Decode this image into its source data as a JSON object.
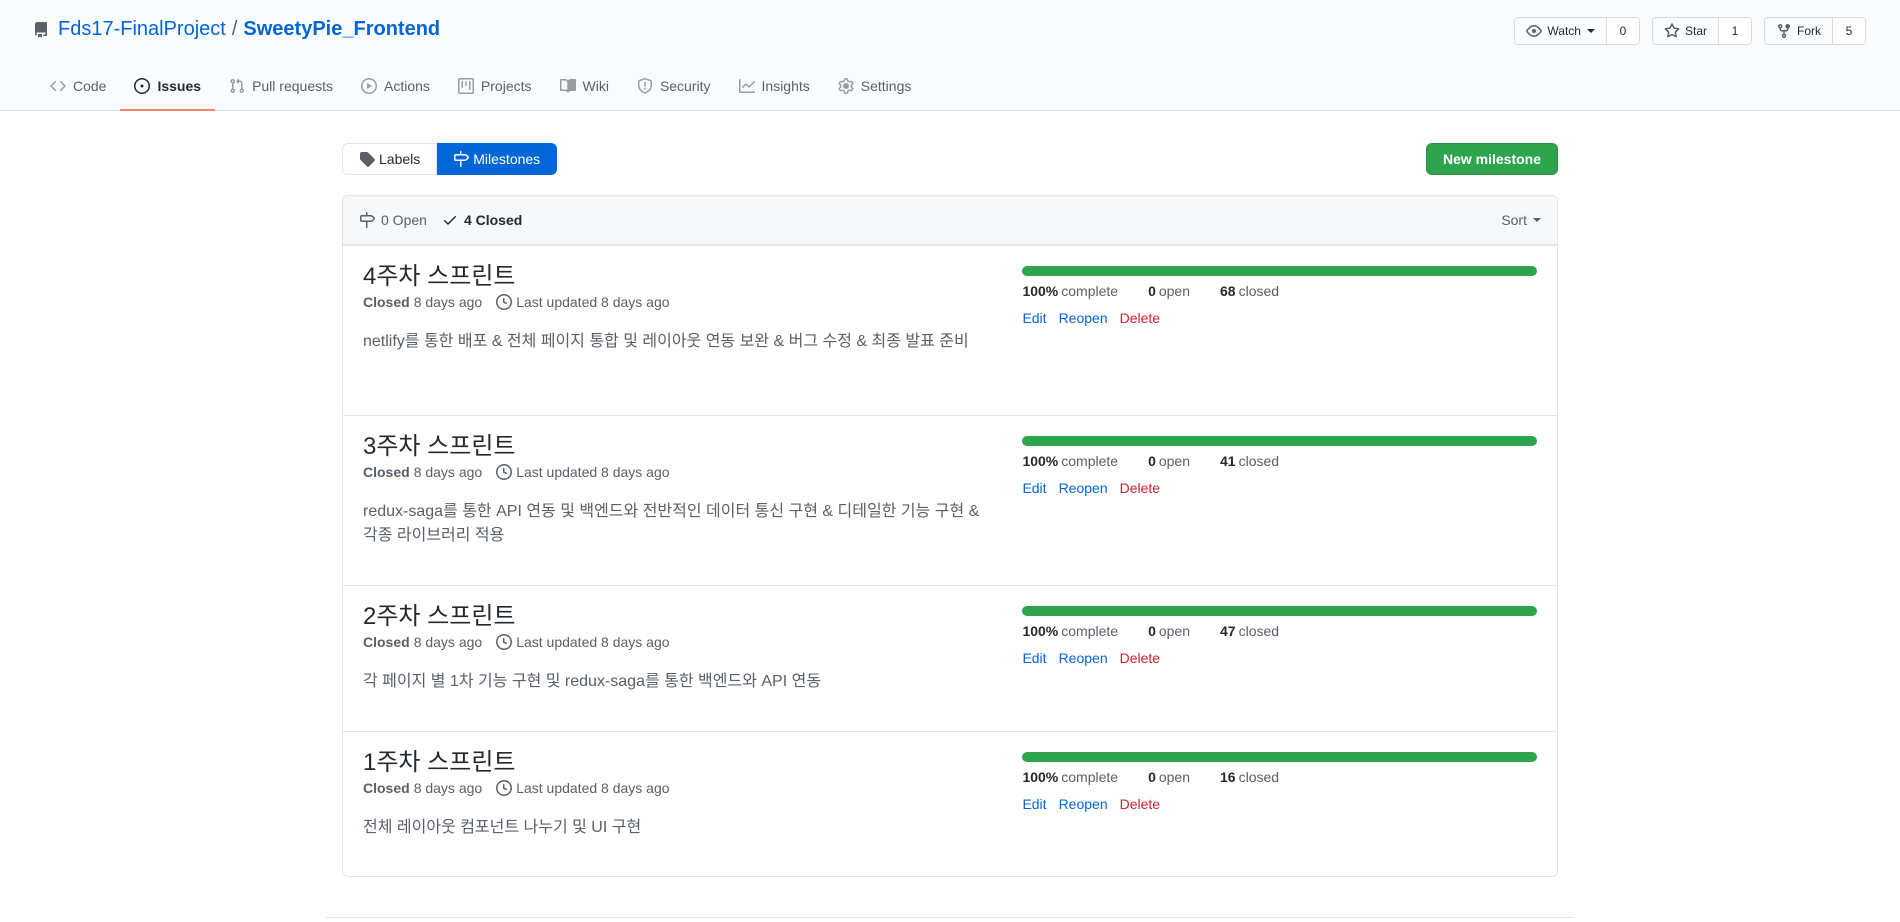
{
  "repo": {
    "owner": "Fds17-FinalProject",
    "separator": "/",
    "name": "SweetyPie_Frontend"
  },
  "actions": {
    "watch_label": "Watch",
    "watch_count": "0",
    "star_label": "Star",
    "star_count": "1",
    "fork_label": "Fork",
    "fork_count": "5"
  },
  "nav": {
    "code": "Code",
    "issues": "Issues",
    "pulls": "Pull requests",
    "actions": "Actions",
    "projects": "Projects",
    "wiki": "Wiki",
    "security": "Security",
    "insights": "Insights",
    "settings": "Settings"
  },
  "subnav": {
    "labels": "Labels",
    "milestones": "Milestones",
    "new_milestone": "New milestone"
  },
  "filter": {
    "open": "0 Open",
    "closed": "4 Closed",
    "sort": "Sort"
  },
  "milestones": [
    {
      "title": "4주차 스프린트",
      "closed_label": "Closed",
      "closed_ago": "8 days ago",
      "updated": "Last updated 8 days ago",
      "description": "netlify를 통한 배포 & 전체 페이지 통합 및 레이아웃 연동 보완 & 버그 수정 & 최종 발표 준비",
      "percent": "100%",
      "complete_label": "complete",
      "open_count": "0",
      "open_label": "open",
      "closed_count": "68",
      "closed_label2": "closed",
      "progress": 1.0,
      "edit": "Edit",
      "reopen": "Reopen",
      "delete": "Delete"
    },
    {
      "title": "3주차 스프린트",
      "closed_label": "Closed",
      "closed_ago": "8 days ago",
      "updated": "Last updated 8 days ago",
      "description": "redux-saga를 통한 API 연동 및 백엔드와 전반적인 데이터 통신 구현 & 디테일한 기능 구현 & 각종 라이브러리 적용",
      "percent": "100%",
      "complete_label": "complete",
      "open_count": "0",
      "open_label": "open",
      "closed_count": "41",
      "closed_label2": "closed",
      "progress": 1.0,
      "edit": "Edit",
      "reopen": "Reopen",
      "delete": "Delete"
    },
    {
      "title": "2주차 스프린트",
      "closed_label": "Closed",
      "closed_ago": "8 days ago",
      "updated": "Last updated 8 days ago",
      "description": "각 페이지 별 1차 기능 구현 및 redux-saga를 통한 백엔드와 API 연동",
      "percent": "100%",
      "complete_label": "complete",
      "open_count": "0",
      "open_label": "open",
      "closed_count": "47",
      "closed_label2": "closed",
      "progress": 1.0,
      "edit": "Edit",
      "reopen": "Reopen",
      "delete": "Delete"
    },
    {
      "title": "1주차 스프린트",
      "closed_label": "Closed",
      "closed_ago": "8 days ago",
      "updated": "Last updated 8 days ago",
      "description": "전체 레이아웃 컴포넌트 나누기 및 UI 구현",
      "percent": "100%",
      "complete_label": "complete",
      "open_count": "0",
      "open_label": "open",
      "closed_count": "16",
      "closed_label2": "closed",
      "progress": 1.0,
      "edit": "Edit",
      "reopen": "Reopen",
      "delete": "Delete"
    }
  ],
  "colors": {
    "link": "#0366d6",
    "success": "#2ea44f",
    "danger": "#cb2431",
    "selected_tab": "#f9826c"
  }
}
